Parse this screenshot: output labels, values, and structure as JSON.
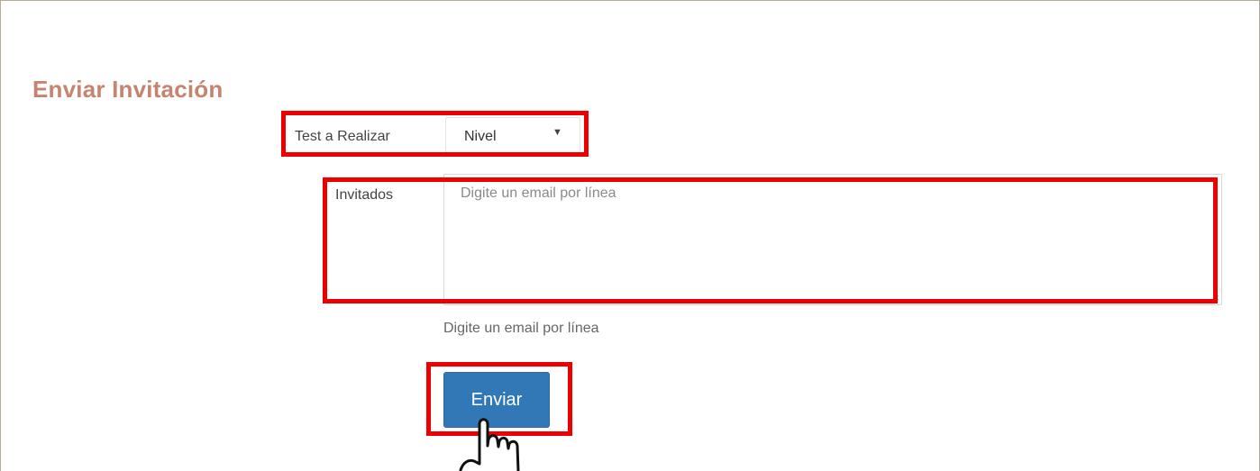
{
  "page": {
    "title": "Enviar Invitación"
  },
  "form": {
    "test_field": {
      "label": "Test a Realizar",
      "selected_value": "Nivel"
    },
    "invitees_field": {
      "label": "Invitados",
      "placeholder": "Digite un email por línea",
      "help_text": "Digite un email por línea"
    },
    "submit": {
      "label": "Enviar"
    }
  },
  "icons": {
    "dropdown": "triangle-down-icon",
    "cursor": "pointer-hand-icon",
    "resize": "resize-grip-icon"
  },
  "colors": {
    "title": "#c5846f",
    "button": "#3278b6",
    "highlight": "#ee0000",
    "frame_border": "#b8ab93"
  }
}
